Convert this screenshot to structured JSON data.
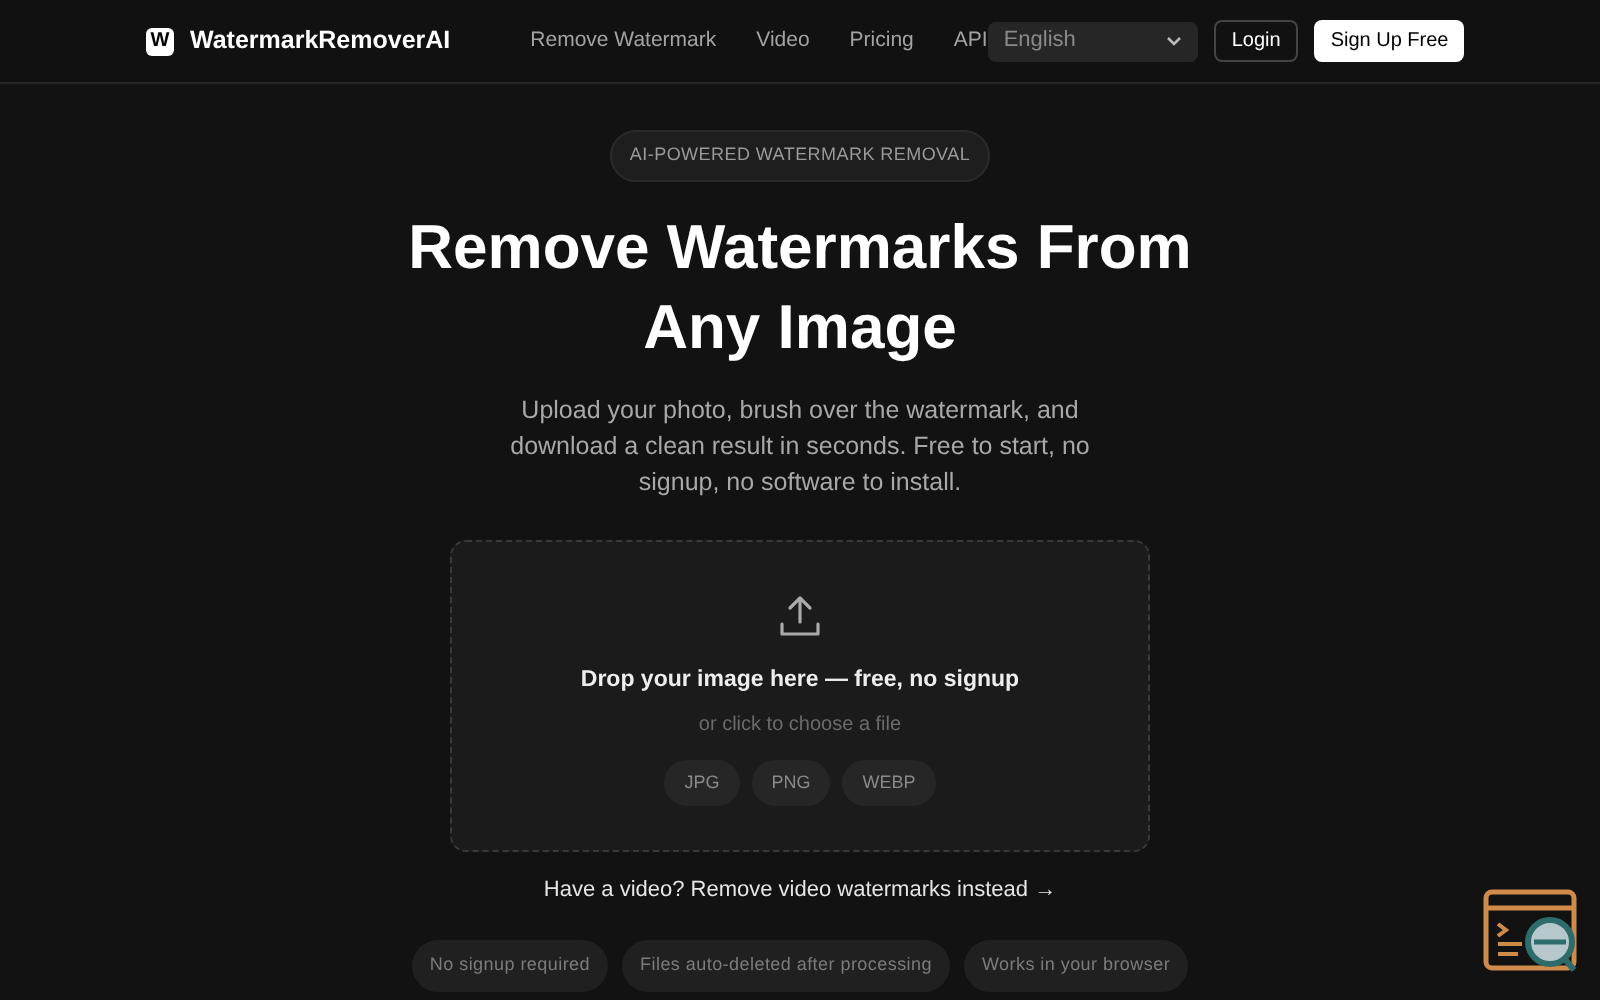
{
  "header": {
    "logo_letter": "W",
    "brand": "WatermarkRemoverAI",
    "nav": [
      "Remove Watermark",
      "Video",
      "Pricing",
      "API"
    ],
    "language": {
      "value": "English"
    },
    "login": "Login",
    "signup": "Sign Up Free"
  },
  "hero": {
    "badge": "AI-POWERED WATERMARK REMOVAL",
    "title_lines": [
      "Remove Watermarks From",
      "Any Image"
    ],
    "subtitle": "Upload your photo, brush over the watermark, and download a clean result in seconds. Free to start, no signup, no software to install."
  },
  "dropzone": {
    "title": "Drop your image here — free, no signup",
    "hint": "or click to choose a file",
    "formats": [
      "JPG",
      "PNG",
      "WEBP"
    ]
  },
  "video_link": "Have a video? Remove video watermarks instead →",
  "features": [
    "No signup required",
    "Files auto-deleted after processing",
    "Works in your browser"
  ]
}
